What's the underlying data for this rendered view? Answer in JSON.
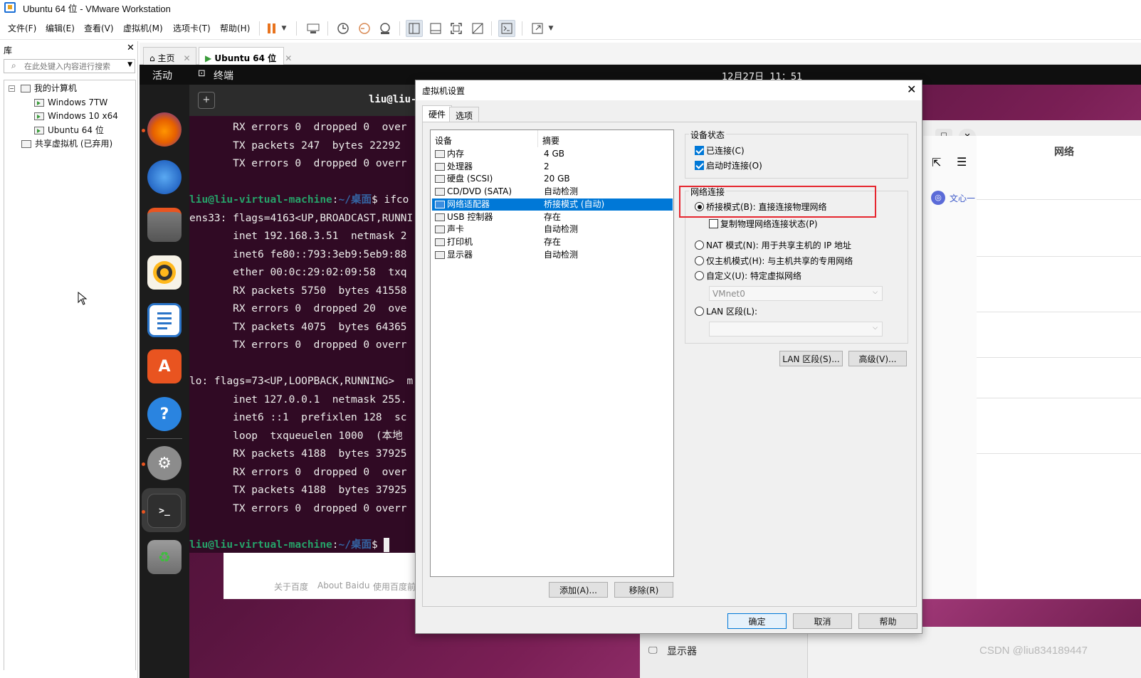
{
  "window": {
    "title": "Ubuntu 64 位 - VMware Workstation"
  },
  "menu": [
    "文件(F)",
    "编辑(E)",
    "查看(V)",
    "虚拟机(M)",
    "选项卡(T)",
    "帮助(H)"
  ],
  "library": {
    "title": "库",
    "search_placeholder": "在此处键入内容进行搜索",
    "tree": {
      "root": "我的计算机",
      "vms": [
        "Windows 7TW",
        "Windows 10 x64",
        "Ubuntu 64 位"
      ],
      "shared": "共享虚拟机 (已弃用)"
    }
  },
  "tabs": [
    {
      "label": "主页"
    },
    {
      "label": "Ubuntu 64 位"
    }
  ],
  "ubuntu": {
    "activities": "活动",
    "app_name": "终端",
    "clock": "12月27日  11：51",
    "dock_icons": [
      "firefox-icon",
      "thunderbird-icon",
      "files-icon",
      "rhythmbox-icon",
      "writer-icon",
      "app-center-icon",
      "help-icon",
      "settings-icon",
      "terminal-icon",
      "trash-icon"
    ],
    "terminal": {
      "title": "liu@liu-vi",
      "prompt_user": "liu@liu-virtual-machine",
      "prompt_path": "~/桌面",
      "lines": [
        "       RX errors 0  dropped 0  over",
        "       TX packets 247  bytes 22292",
        "       TX errors 0  dropped 0 overr",
        "",
        "__PROMPT__ifco",
        "ens33: flags=4163<UP,BROADCAST,RUNNI",
        "       inet 192.168.3.51  netmask 2",
        "       inet6 fe80::793:3eb9:5eb9:88",
        "       ether 00:0c:29:02:09:58  txq",
        "       RX packets 5750  bytes 41558",
        "       RX errors 0  dropped 20  ove",
        "       TX packets 4075  bytes 64365",
        "       TX errors 0  dropped 0 overr",
        "",
        "lo: flags=73<UP,LOOPBACK,RUNNING>  m",
        "       inet 127.0.0.1  netmask 255.",
        "       inet6 ::1  prefixlen 128  sc",
        "       loop  txqueuelen 1000  (本地",
        "       RX packets 4188  bytes 37925",
        "       RX errors 0  dropped 0  over",
        "       TX packets 4188  bytes 37925",
        "       TX errors 0  dropped 0 overr",
        "",
        "__PROMPT__"
      ]
    },
    "browser_links": [
      "关于百度",
      "About Baidu",
      "使用百度前"
    ],
    "settings": {
      "title": "网络",
      "sidebar_item": "文心一",
      "display_label": "显示器"
    }
  },
  "dialog": {
    "title": "虚拟机设置",
    "tabs": [
      "硬件",
      "选项"
    ],
    "columns": [
      "设备",
      "摘要"
    ],
    "devices": [
      {
        "name": "内存",
        "summary": "4 GB",
        "icon": "memory-icon"
      },
      {
        "name": "处理器",
        "summary": "2",
        "icon": "cpu-icon"
      },
      {
        "name": "硬盘 (SCSI)",
        "summary": "20 GB",
        "icon": "disk-icon"
      },
      {
        "name": "CD/DVD (SATA)",
        "summary": "自动检测",
        "icon": "cd-icon"
      },
      {
        "name": "网络适配器",
        "summary": "桥接模式 (自动)",
        "icon": "network-icon",
        "selected": true
      },
      {
        "name": "USB 控制器",
        "summary": "存在",
        "icon": "usb-icon"
      },
      {
        "name": "声卡",
        "summary": "自动检测",
        "icon": "sound-icon"
      },
      {
        "name": "打印机",
        "summary": "存在",
        "icon": "printer-icon"
      },
      {
        "name": "显示器",
        "summary": "自动检测",
        "icon": "display-icon"
      }
    ],
    "add_button": "添加(A)...",
    "remove_button": "移除(R)",
    "device_status": {
      "label": "设备状态",
      "connected": "已连接(C)",
      "connect_on_power": "启动时连接(O)"
    },
    "network": {
      "label": "网络连接",
      "bridged": "桥接模式(B): 直接连接物理网络",
      "replicate": "复制物理网络连接状态(P)",
      "nat": "NAT 模式(N): 用于共享主机的 IP 地址",
      "host_only": "仅主机模式(H): 与主机共享的专用网络",
      "custom": "自定义(U): 特定虚拟网络",
      "vmnet": "VMnet0",
      "lan": "LAN 区段(L):",
      "lan_segments_button": "LAN 区段(S)...",
      "advanced_button": "高级(V)..."
    },
    "ok": "确定",
    "cancel": "取消",
    "help": "帮助"
  },
  "watermark": "CSDN @liu834189447"
}
